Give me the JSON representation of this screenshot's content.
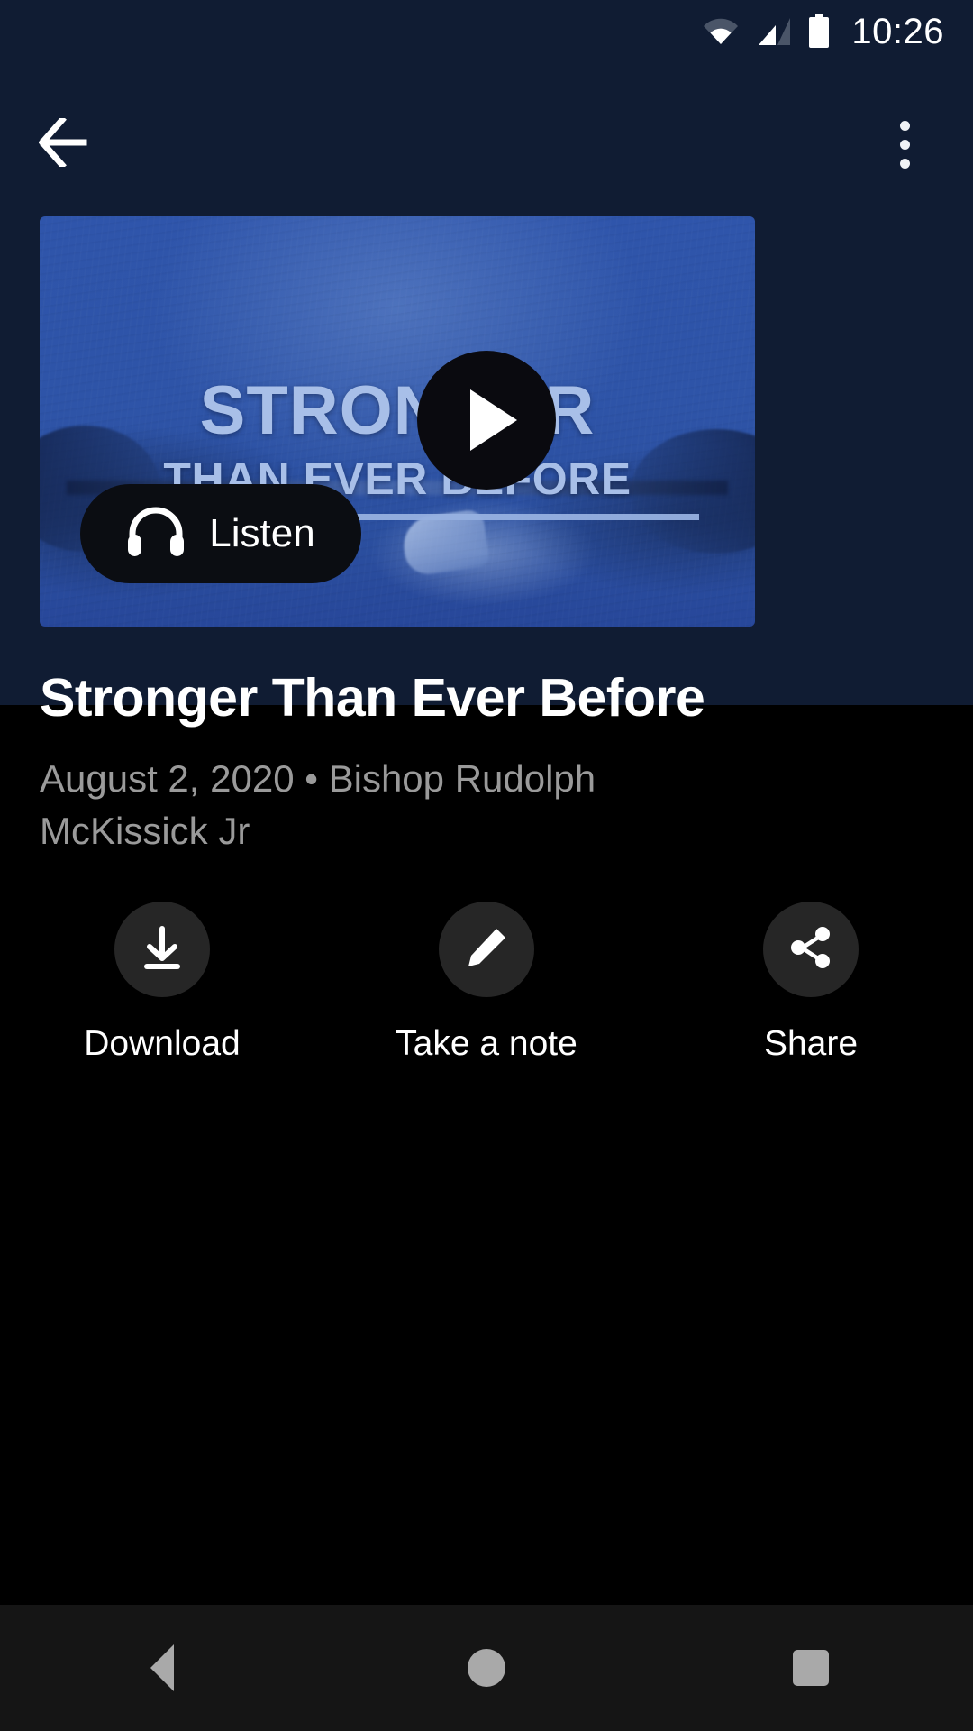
{
  "status_bar": {
    "time": "10:26",
    "icons": [
      "wifi-icon",
      "cellular-signal-icon",
      "battery-icon"
    ]
  },
  "app_bar": {
    "back_icon": "back-arrow-icon",
    "overflow_icon": "overflow-menu-icon"
  },
  "media": {
    "thumbnail": {
      "headline": "STRONGER",
      "subheadline": "THAN EVER BEFORE",
      "background_color": "#2e54a8",
      "text_color": "#a8bfe8"
    },
    "play_button": {
      "icon": "play-icon",
      "label": "Play"
    },
    "listen_button": {
      "icon": "headphones-icon",
      "label": "Listen"
    }
  },
  "episode": {
    "title": "Stronger Than Ever Before",
    "meta": "August 2, 2020 • Bishop Rudolph McKissick Jr",
    "date": "August 2, 2020",
    "speaker": "Bishop Rudolph McKissick Jr"
  },
  "actions": [
    {
      "label": "Download",
      "icon": "download-icon"
    },
    {
      "label": "Take a note",
      "icon": "pencil-icon"
    },
    {
      "label": "Share",
      "icon": "share-icon"
    }
  ],
  "navigation_bar": {
    "back": "back-nav-icon",
    "home": "home-nav-icon",
    "recents": "recents-nav-icon"
  },
  "theme": {
    "background": "#000000",
    "hero_background": "#101c33",
    "accent_blue": "#2e54a8",
    "muted_text": "#9a9a9a"
  }
}
